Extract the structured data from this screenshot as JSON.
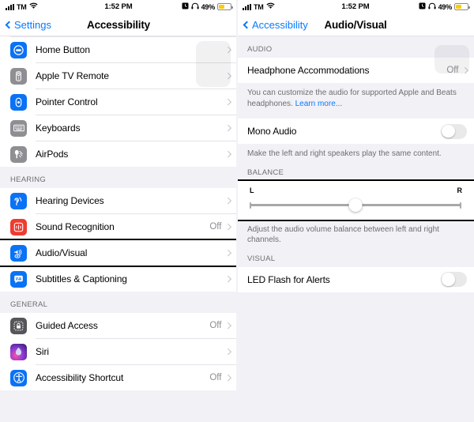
{
  "statusbar": {
    "carrier": "TM",
    "time": "1:52 PM",
    "battery_pct": "49%",
    "wifi_icon": "wifi-icon",
    "signal_icon": "cellular-signal-icon",
    "alarm_icon": "alarm-icon",
    "headphones_icon": "headphones-icon",
    "battery_icon": "battery-icon",
    "battery_color": "#fccb0b"
  },
  "left_panel": {
    "nav": {
      "back_label": "Settings",
      "title": "Accessibility",
      "back_icon": "chevron-left-icon",
      "accent": "#067aff"
    },
    "sections": [
      {
        "header": "",
        "items": [
          {
            "label": "Home Button",
            "value": "",
            "icon": "home-button-icon",
            "icon_color": "#0a72f5"
          },
          {
            "label": "Apple TV Remote",
            "value": "",
            "icon": "apple-tv-remote-icon",
            "icon_color": "#8e8e93"
          },
          {
            "label": "Pointer Control",
            "value": "",
            "icon": "pointer-control-icon",
            "icon_color": "#0a72f5"
          },
          {
            "label": "Keyboards",
            "value": "",
            "icon": "keyboard-icon",
            "icon_color": "#8e8e93"
          },
          {
            "label": "AirPods",
            "value": "",
            "icon": "airpods-icon",
            "icon_color": "#8e8e93"
          }
        ]
      },
      {
        "header": "HEARING",
        "items": [
          {
            "label": "Hearing Devices",
            "value": "",
            "icon": "hearing-devices-icon",
            "icon_color": "#0a72f5"
          },
          {
            "label": "Sound Recognition",
            "value": "Off",
            "icon": "sound-recognition-icon",
            "icon_color": "#f03b30"
          },
          {
            "label": "Audio/Visual",
            "value": "",
            "icon": "audio-visual-icon",
            "icon_color": "#0a72f5",
            "highlighted": true
          },
          {
            "label": "Subtitles & Captioning",
            "value": "",
            "icon": "subtitles-captioning-icon",
            "icon_color": "#0a72f5"
          }
        ]
      },
      {
        "header": "GENERAL",
        "items": [
          {
            "label": "Guided Access",
            "value": "Off",
            "icon": "guided-access-icon",
            "icon_color": "#55555a"
          },
          {
            "label": "Siri",
            "value": "",
            "icon": "siri-icon",
            "icon_color": "#8d3bd6"
          },
          {
            "label": "Accessibility Shortcut",
            "value": "Off",
            "icon": "accessibility-shortcut-icon",
            "icon_color": "#0a72f5"
          }
        ]
      }
    ]
  },
  "right_panel": {
    "nav": {
      "back_label": "Accessibility",
      "title": "Audio/Visual",
      "back_icon": "chevron-left-icon",
      "accent": "#067aff"
    },
    "audio": {
      "header": "AUDIO",
      "headphone_accommodations_label": "Headphone Accommodations",
      "headphone_accommodations_value": "Off",
      "footnote_text": "You can customize the audio for supported Apple and Beats headphones. ",
      "footnote_link": "Learn more...",
      "mono_audio_label": "Mono Audio",
      "mono_audio_state": "off",
      "mono_audio_footnote": "Make the left and right speakers play the same content."
    },
    "balance": {
      "header": "BALANCE",
      "left_label": "L",
      "right_label": "R",
      "value": 50,
      "footnote": "Adjust the audio volume balance between left and right channels."
    },
    "visual": {
      "header": "VISUAL",
      "led_flash_label": "LED Flash for Alerts",
      "led_flash_state": "off"
    }
  }
}
